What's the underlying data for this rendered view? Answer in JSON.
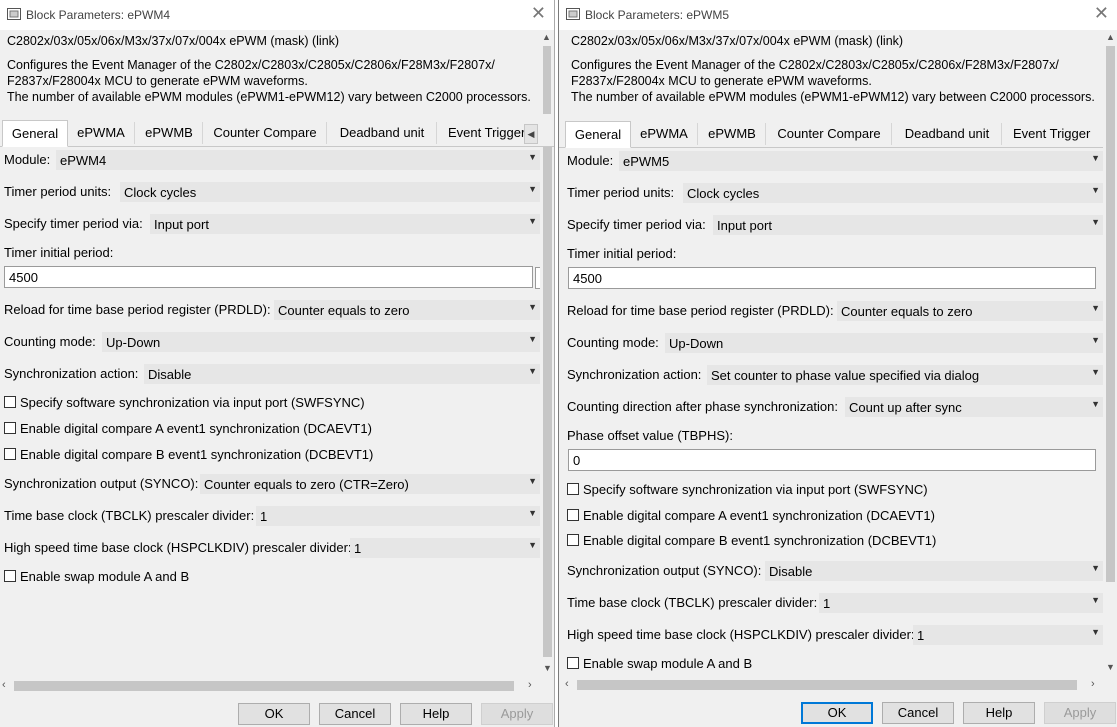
{
  "dialogs": [
    {
      "title": "Block Parameters: ePWM4",
      "mask_header": "C2802x/03x/05x/06x/M3x/37x/07x/004x ePWM (mask) (link)",
      "description": [
        "Configures the Event Manager of the C2802x/C2803x/C2805x/C2806x/F28M3x/F2807x/",
        "F2837x/F28004x MCU to generate ePWM waveforms.",
        "The number of available ePWM modules (ePWM1-ePWM12) vary between C2000 processors."
      ],
      "tabs": [
        "General",
        "ePWMA",
        "ePWMB",
        "Counter Compare",
        "Deadband unit",
        "Event Trigger"
      ],
      "fields": {
        "module": {
          "label": "Module:",
          "value": "ePWM4"
        },
        "timer_period_units": {
          "label": "Timer period units:",
          "value": "Clock cycles"
        },
        "specify_timer_period": {
          "label": "Specify timer period via:",
          "value": "Input port"
        },
        "timer_initial_period": {
          "label": "Timer initial period:",
          "value": "4500"
        },
        "reload": {
          "label": "Reload for time base period register (PRDLD):",
          "value": "Counter equals to zero"
        },
        "counting_mode": {
          "label": "Counting mode:",
          "value": "Up-Down"
        },
        "sync_action": {
          "label": "Synchronization action:",
          "value": "Disable"
        },
        "swfsync": {
          "label": "Specify software synchronization via input port (SWFSYNC)"
        },
        "dcaevt1": {
          "label": "Enable digital compare A event1 synchronization (DCAEVT1)"
        },
        "dcbevt1": {
          "label": "Enable digital compare B event1 synchronization (DCBEVT1)"
        },
        "synco": {
          "label": "Synchronization output (SYNCO):",
          "value": "Counter equals to zero (CTR=Zero)"
        },
        "tbclk": {
          "label": "Time base clock (TBCLK) prescaler divider:",
          "value": "1"
        },
        "hspclkdiv": {
          "label": "High speed time base clock (HSPCLKDIV) prescaler divider:",
          "value": "1"
        },
        "swap": {
          "label": "Enable swap module A and B"
        }
      },
      "buttons": {
        "ok": "OK",
        "cancel": "Cancel",
        "help": "Help",
        "apply": "Apply"
      }
    },
    {
      "title": "Block Parameters: ePWM5",
      "mask_header": "C2802x/03x/05x/06x/M3x/37x/07x/004x ePWM (mask) (link)",
      "description": [
        "Configures the Event Manager of the C2802x/C2803x/C2805x/C2806x/F28M3x/F2807x/",
        "F2837x/F28004x MCU to generate ePWM waveforms.",
        "The number of available ePWM modules (ePWM1-ePWM12) vary between C2000 processors."
      ],
      "tabs": [
        "General",
        "ePWMA",
        "ePWMB",
        "Counter Compare",
        "Deadband unit",
        "Event Trigger"
      ],
      "fields": {
        "module": {
          "label": "Module:",
          "value": "ePWM5"
        },
        "timer_period_units": {
          "label": "Timer period units:",
          "value": "Clock cycles"
        },
        "specify_timer_period": {
          "label": "Specify timer period via:",
          "value": "Input port"
        },
        "timer_initial_period": {
          "label": "Timer initial period:",
          "value": "4500"
        },
        "reload": {
          "label": "Reload for time base period register (PRDLD):",
          "value": "Counter equals to zero"
        },
        "counting_mode": {
          "label": "Counting mode:",
          "value": "Up-Down"
        },
        "sync_action": {
          "label": "Synchronization action:",
          "value": "Set counter to phase value specified via dialog"
        },
        "count_dir": {
          "label": "Counting direction after phase synchronization:",
          "value": "Count up after sync"
        },
        "phase_offset": {
          "label": "Phase offset value (TBPHS):",
          "value": "0"
        },
        "swfsync": {
          "label": "Specify software synchronization via input port (SWFSYNC)"
        },
        "dcaevt1": {
          "label": "Enable digital compare A event1 synchronization (DCAEVT1)"
        },
        "dcbevt1": {
          "label": "Enable digital compare B event1 synchronization (DCBEVT1)"
        },
        "synco": {
          "label": "Synchronization output (SYNCO):",
          "value": "Disable"
        },
        "tbclk": {
          "label": "Time base clock (TBCLK) prescaler divider:",
          "value": "1"
        },
        "hspclkdiv": {
          "label": "High speed time base clock (HSPCLKDIV) prescaler divider:",
          "value": "1"
        },
        "swap": {
          "label": "Enable swap module A and B"
        }
      },
      "buttons": {
        "ok": "OK",
        "cancel": "Cancel",
        "help": "Help",
        "apply": "Apply"
      }
    }
  ],
  "icons": {
    "app": "simulink-block-icon",
    "close": "close-icon",
    "dropdown": "chevron-down-icon",
    "scroll_up": "arrow-up-icon",
    "scroll_down": "arrow-down-icon",
    "scroll_left": "arrow-left-icon",
    "scroll_right": "arrow-right-icon"
  },
  "colors": {
    "default_button_border": "#0078d7",
    "dropdown_bg": "#e6e6e6",
    "window_bg": "#f0f0f0"
  }
}
